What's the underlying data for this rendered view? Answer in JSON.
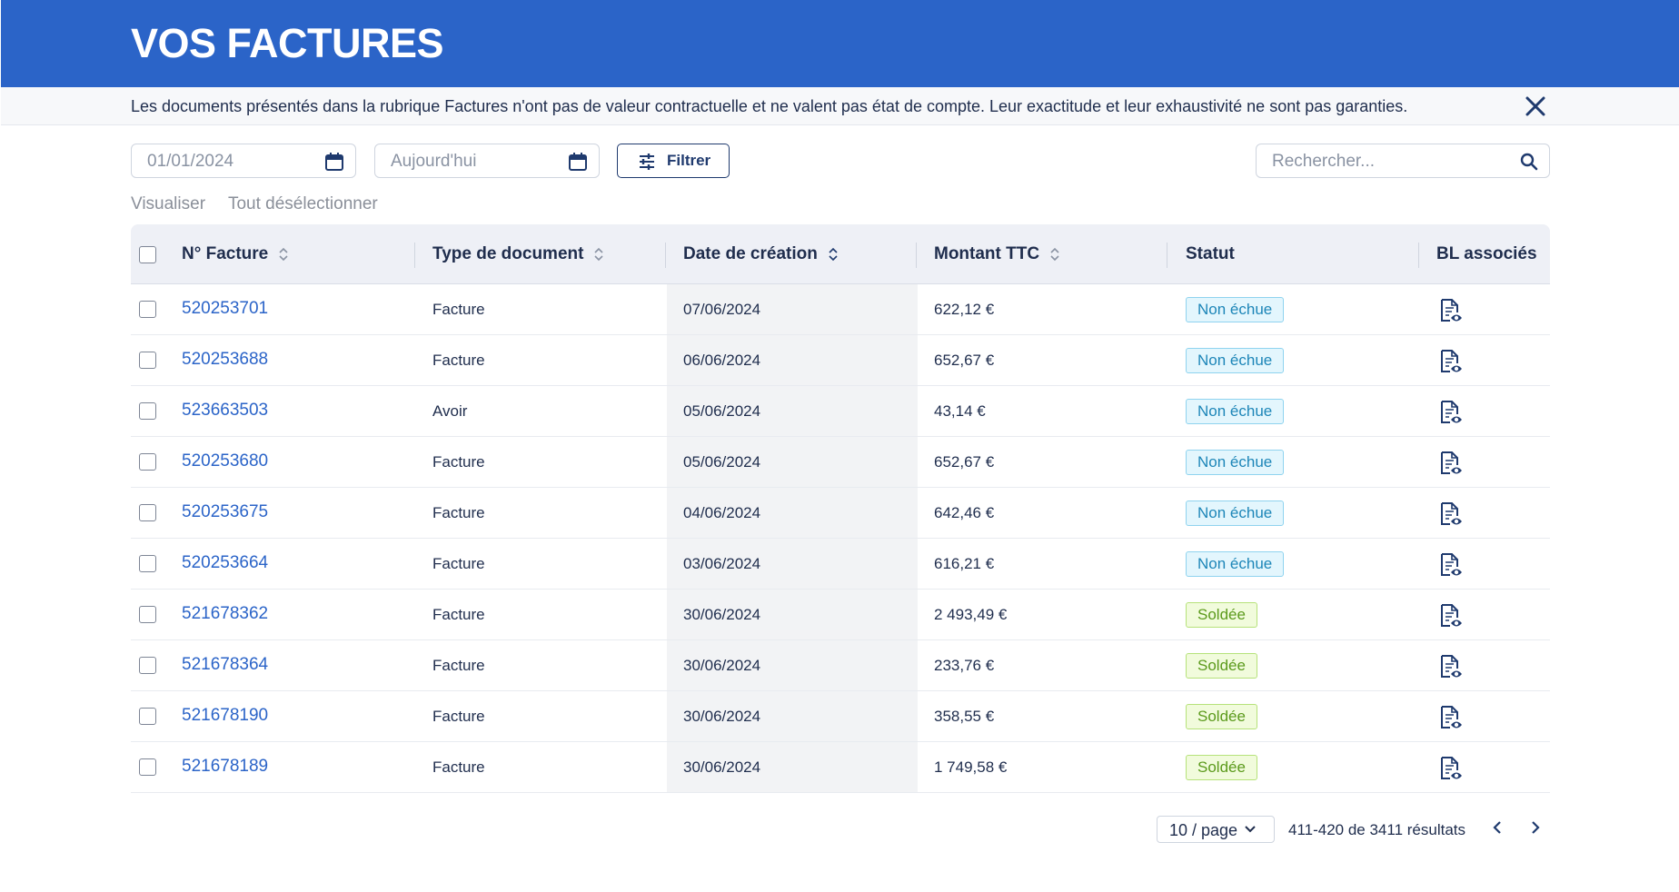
{
  "header": {
    "title": "VOS FACTURES"
  },
  "notice": {
    "text": "Les documents présentés dans la rubrique Factures n'ont pas de valeur contractuelle et ne valent pas état de compte. Leur exactitude et leur exhaustivité ne sont pas garanties."
  },
  "filters": {
    "date_from_value": "01/01/2024",
    "date_to_placeholder": "Aujourd'hui",
    "filter_label": "Filtrer",
    "search_placeholder": "Rechercher..."
  },
  "actions": {
    "view": "Visualiser",
    "deselect": "Tout désélectionner"
  },
  "table": {
    "columns": [
      "N° Facture",
      "Type de document",
      "Date de création",
      "Montant TTC",
      "Statut",
      "BL associés"
    ],
    "rows": [
      {
        "num": "520253701",
        "type": "Facture",
        "date": "07/06/2024",
        "amount": "622,12 €",
        "status": "Non échue"
      },
      {
        "num": "520253688",
        "type": "Facture",
        "date": "06/06/2024",
        "amount": "652,67 €",
        "status": "Non échue"
      },
      {
        "num": "523663503",
        "type": "Avoir",
        "date": "05/06/2024",
        "amount": "43,14 €",
        "status": "Non échue"
      },
      {
        "num": "520253680",
        "type": "Facture",
        "date": "05/06/2024",
        "amount": "652,67 €",
        "status": "Non échue"
      },
      {
        "num": "520253675",
        "type": "Facture",
        "date": "04/06/2024",
        "amount": "642,46 €",
        "status": "Non échue"
      },
      {
        "num": "520253664",
        "type": "Facture",
        "date": "03/06/2024",
        "amount": "616,21 €",
        "status": "Non échue"
      },
      {
        "num": "521678362",
        "type": "Facture",
        "date": "30/06/2024",
        "amount": "2 493,49 €",
        "status": "Soldée"
      },
      {
        "num": "521678364",
        "type": "Facture",
        "date": "30/06/2024",
        "amount": "233,76 €",
        "status": "Soldée"
      },
      {
        "num": "521678190",
        "type": "Facture",
        "date": "30/06/2024",
        "amount": "358,55 €",
        "status": "Soldée"
      },
      {
        "num": "521678189",
        "type": "Facture",
        "date": "30/06/2024",
        "amount": "1 749,58 €",
        "status": "Soldée"
      }
    ]
  },
  "pagination": {
    "page_size": "10 / page",
    "range": "411-420 de 3411 résultats"
  },
  "colors": {
    "brand": "#2b64c8",
    "pending": "#1d86b8",
    "paid": "#5b9a1b"
  }
}
